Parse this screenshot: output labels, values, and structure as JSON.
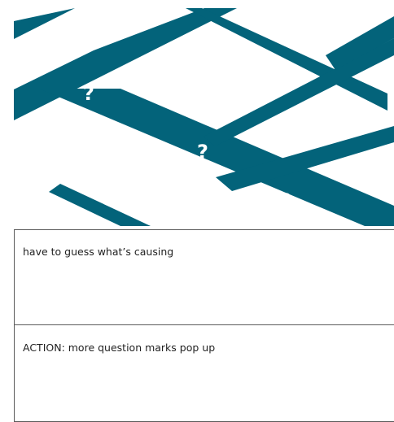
{
  "scene": {
    "stripe_color": "#03637a",
    "background_color": "#ffffff",
    "question_marks": [
      "?",
      "?",
      "?",
      "?",
      "?"
    ]
  },
  "panels": [
    {
      "text": "have to guess what’s causing"
    },
    {
      "text": "ACTION: more question marks pop up"
    }
  ]
}
